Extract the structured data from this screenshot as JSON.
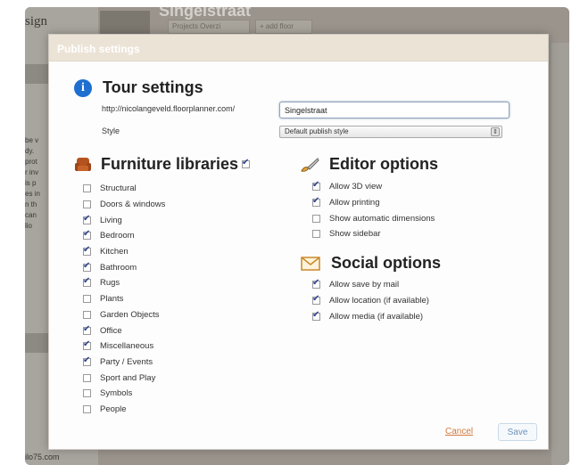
{
  "background": {
    "logo_text": "sign",
    "page_title": "Singelstraat",
    "link_label": "Projects Overzi",
    "add_floor_label": "+ add floor",
    "side_text": [
      "be v",
      "dy.",
      "prot",
      "r inv",
      "is p",
      "es in",
      "n th",
      "can",
      "lio"
    ],
    "footer_url": "ilo75.com"
  },
  "modal": {
    "title": "Publish settings",
    "tour": {
      "heading": "Tour settings",
      "url_prefix": "http://nicolangeveld.floorplanner.com/",
      "url_value": "Singelstraat",
      "style_label": "Style",
      "style_value": "Default publish style"
    },
    "furniture": {
      "heading": "Furniture libraries",
      "all_checked": true,
      "items": [
        {
          "label": "Structural",
          "checked": false
        },
        {
          "label": "Doors & windows",
          "checked": false
        },
        {
          "label": "Living",
          "checked": true
        },
        {
          "label": "Bedroom",
          "checked": true
        },
        {
          "label": "Kitchen",
          "checked": true
        },
        {
          "label": "Bathroom",
          "checked": true
        },
        {
          "label": "Rugs",
          "checked": true
        },
        {
          "label": "Plants",
          "checked": false
        },
        {
          "label": "Garden Objects",
          "checked": false
        },
        {
          "label": "Office",
          "checked": true
        },
        {
          "label": "Miscellaneous",
          "checked": true
        },
        {
          "label": "Party / Events",
          "checked": true
        },
        {
          "label": "Sport and Play",
          "checked": false
        },
        {
          "label": "Symbols",
          "checked": false
        },
        {
          "label": "People",
          "checked": false
        }
      ]
    },
    "editor": {
      "heading": "Editor options",
      "items": [
        {
          "label": "Allow 3D view",
          "checked": true
        },
        {
          "label": "Allow printing",
          "checked": true
        },
        {
          "label": "Show automatic dimensions",
          "checked": false
        },
        {
          "label": "Show sidebar",
          "checked": false
        }
      ]
    },
    "social": {
      "heading": "Social options",
      "items": [
        {
          "label": "Allow save by mail",
          "checked": true
        },
        {
          "label": "Allow location (if available)",
          "checked": true
        },
        {
          "label": "Allow media (if available)",
          "checked": true
        }
      ]
    },
    "cancel_label": "Cancel",
    "save_label": "Save"
  },
  "colors": {
    "info_icon": "#1e6fcf",
    "checkmark": "#2a3f8c",
    "cancel_link": "#d27a40",
    "save_text": "#6d92bb",
    "header_bg": "#ece3d7"
  }
}
